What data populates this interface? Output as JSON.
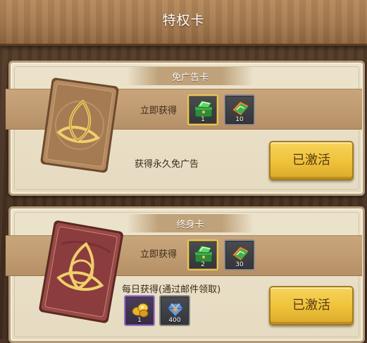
{
  "header": {
    "title": "特权卡"
  },
  "cards": [
    {
      "title": "免广告卡",
      "instant_label": "立即获得",
      "instant_rewards": [
        {
          "icon": "green-ticket-chest-icon",
          "count": "1",
          "frame": "gold"
        },
        {
          "icon": "green-ticket-icon",
          "count": "10",
          "frame": "gray"
        }
      ],
      "description": "获得永久免广告",
      "button_label": "已激活",
      "card_art": "brown-knot-card-icon"
    },
    {
      "title": "终身卡",
      "instant_label": "立即获得",
      "instant_rewards": [
        {
          "icon": "green-ticket-chest-icon",
          "count": "2",
          "frame": "gold"
        },
        {
          "icon": "green-ticket-icon",
          "count": "30",
          "frame": "gray"
        }
      ],
      "daily_label": "每日获得(通过邮件领取)",
      "daily_rewards": [
        {
          "icon": "gold-coin-pile-icon",
          "count": "1",
          "frame": "purple"
        },
        {
          "icon": "blue-gem-icon",
          "count": "400",
          "frame": "gray"
        }
      ],
      "button_label": "已激活",
      "card_art": "crimson-knot-card-icon"
    }
  ],
  "colors": {
    "button_yellow": "#eec13a",
    "panel_cream": "#e9dfc6",
    "strip_tan": "#c19c72",
    "slot_gold_border": "#e7c75a",
    "slot_purple_border": "#9d74c9"
  }
}
